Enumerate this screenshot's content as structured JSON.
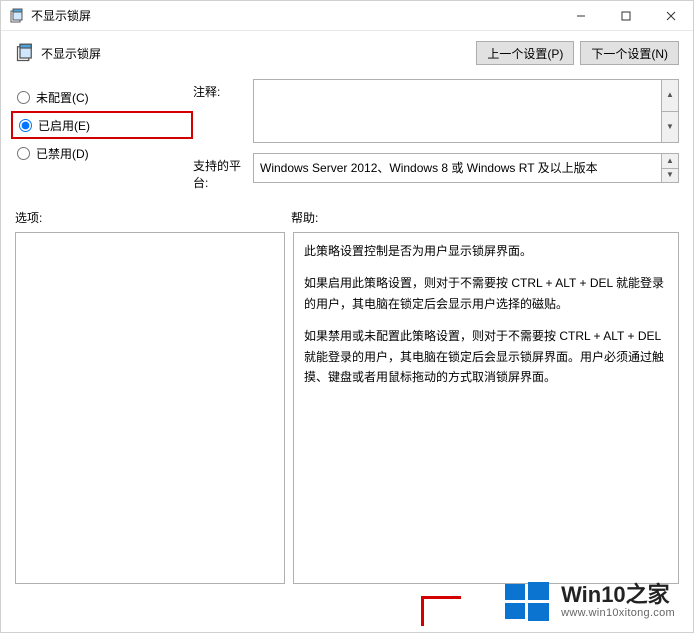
{
  "window": {
    "title": "不显示锁屏"
  },
  "header": {
    "title": "不显示锁屏",
    "prev_btn": "上一个设置(P)",
    "next_btn": "下一个设置(N)"
  },
  "radio": {
    "not_configured": "未配置(C)",
    "enabled": "已启用(E)",
    "disabled": "已禁用(D)",
    "selected": "enabled"
  },
  "fields": {
    "comment_label": "注释:",
    "comment_value": "",
    "platform_label": "支持的平台:",
    "platform_value": "Windows Server 2012、Windows 8 或 Windows RT 及以上版本"
  },
  "sections": {
    "options_label": "选项:",
    "help_label": "帮助:"
  },
  "help": {
    "p1": "此策略设置控制是否为用户显示锁屏界面。",
    "p2": "如果启用此策略设置，则对于不需要按 CTRL + ALT + DEL  就能登录的用户，其电脑在锁定后会显示用户选择的磁贴。",
    "p3": "如果禁用或未配置此策略设置，则对于不需要按 CTRL + ALT + DEL 就能登录的用户，其电脑在锁定后会显示锁屏界面。用户必须通过触摸、键盘或者用鼠标拖动的方式取消锁屏界面。"
  },
  "watermark": {
    "brand_head": "Win10",
    "brand_tail": "之家",
    "url": "www.win10xitong.com"
  }
}
